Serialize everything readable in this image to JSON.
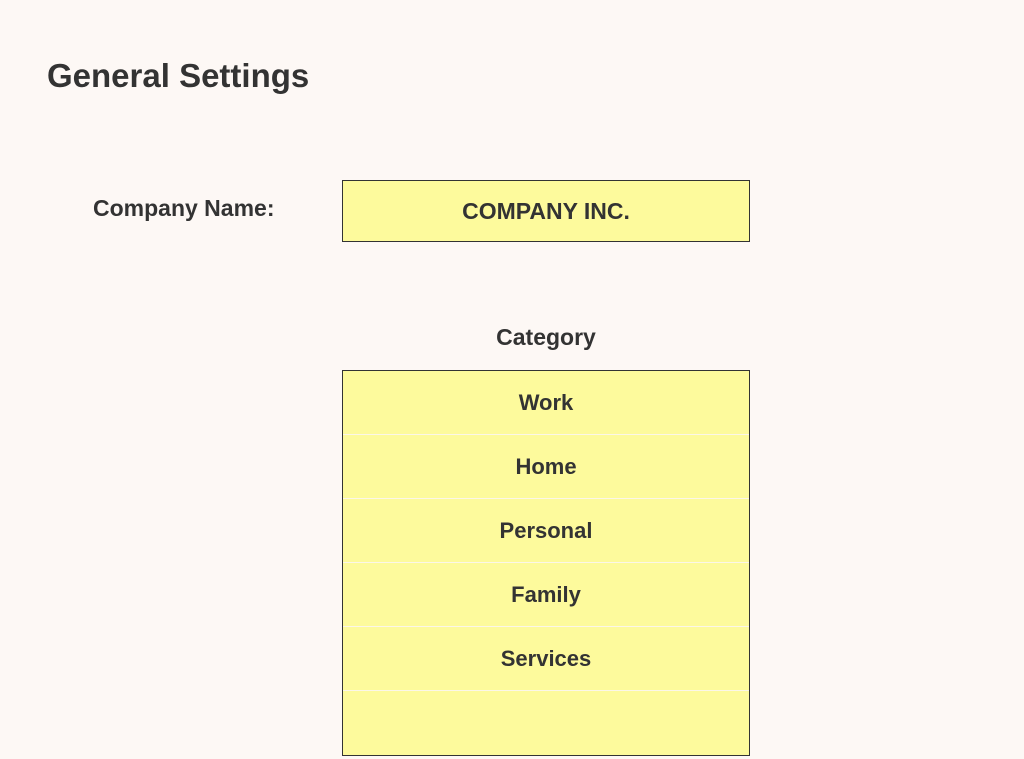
{
  "heading": "General Settings",
  "company": {
    "label": "Company Name:",
    "value": "COMPANY INC."
  },
  "category": {
    "label": "Category",
    "items": [
      "Work",
      "Home",
      "Personal",
      "Family",
      "Services",
      ""
    ]
  }
}
